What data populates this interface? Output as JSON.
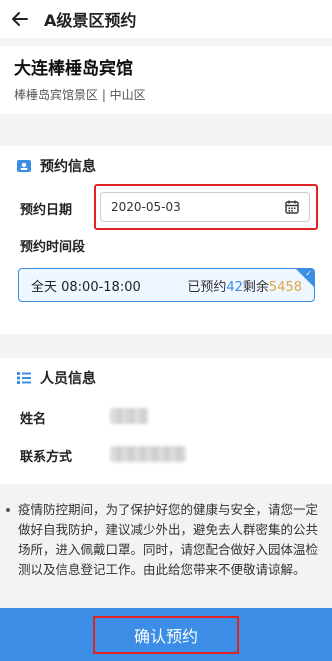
{
  "header": {
    "title": "A级景区预约"
  },
  "venue": {
    "name": "大连棒棰岛宾馆",
    "location": "棒棰岛宾馆景区 | 中山区"
  },
  "booking": {
    "section_title": "预约信息",
    "date_label": "预约日期",
    "date_value": "2020-05-03",
    "slot_label": "预约时间段",
    "slot": {
      "time": "全天 08:00-18:00",
      "booked_prefix": "已预约",
      "booked": "42",
      "left_prefix": "剩余",
      "left": "5458",
      "selected": true
    }
  },
  "person": {
    "section_title": "人员信息",
    "name_label": "姓名",
    "phone_label": "联系方式"
  },
  "notice": "疫情防控期间，为了保护好您的健康与安全，请您一定做好自我防护，建议减少外出，避免去人群密集的公共场所，进入佩戴口罩。同时，请您配合做好入园体温检测以及信息登记工作。由此给您带来不便敬请谅解。",
  "footer": {
    "confirm_label": "确认预约"
  },
  "colors": {
    "accent": "#3b8de6",
    "booked": "#3b8de6",
    "remaining": "#e0a83a",
    "highlight": "#e02424"
  },
  "icons": {
    "back": "arrow-left-icon",
    "calendar": "calendar-icon",
    "booking": "booking-card-icon",
    "person": "list-icon",
    "check": "check-icon"
  }
}
